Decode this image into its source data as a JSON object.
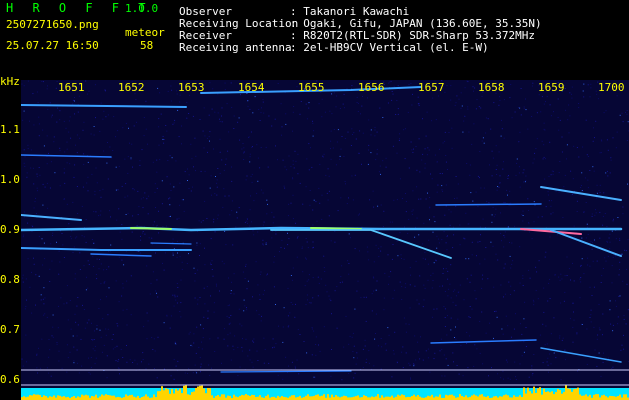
{
  "header": {
    "app_title": "H R O F F T",
    "version": "1.0.0",
    "file_name": "2507271650.png",
    "meteor_label": "meteor",
    "datetime": "25.07.27 16:50",
    "meteor_count": "58",
    "fields": [
      {
        "label": "Observer",
        "value": ": Takanori Kawachi"
      },
      {
        "label": "Receiving Location",
        "value": ": Ogaki, Gifu, JAPAN (136.60E, 35.35N)"
      },
      {
        "label": "Receiver",
        "value": ": R820T2(RTL-SDR) SDR-Sharp 53.372MHz"
      },
      {
        "label": "Receiving antenna",
        "value": ": 2el-HB9CV Vertical (el. E-W)"
      }
    ]
  },
  "axes": {
    "y_unit": "kHz",
    "y_ticks": [
      "1.1",
      "1.0",
      "0.9",
      "0.8",
      "0.7",
      "0.6"
    ],
    "x_ticks": [
      "1651",
      "1652",
      "1653",
      "1654",
      "1655",
      "1656",
      "1657",
      "1658",
      "1659",
      "1700"
    ]
  },
  "colors": {
    "background": "#000000",
    "green_text": "#00ff00",
    "yellow_text": "#ffff00",
    "white_text": "#ffffff",
    "noise": "#0a0a5a",
    "echo": "#3aa0ff",
    "bottom_bar": "#00e5ff",
    "bottom_peaks": "#ffd400"
  }
}
